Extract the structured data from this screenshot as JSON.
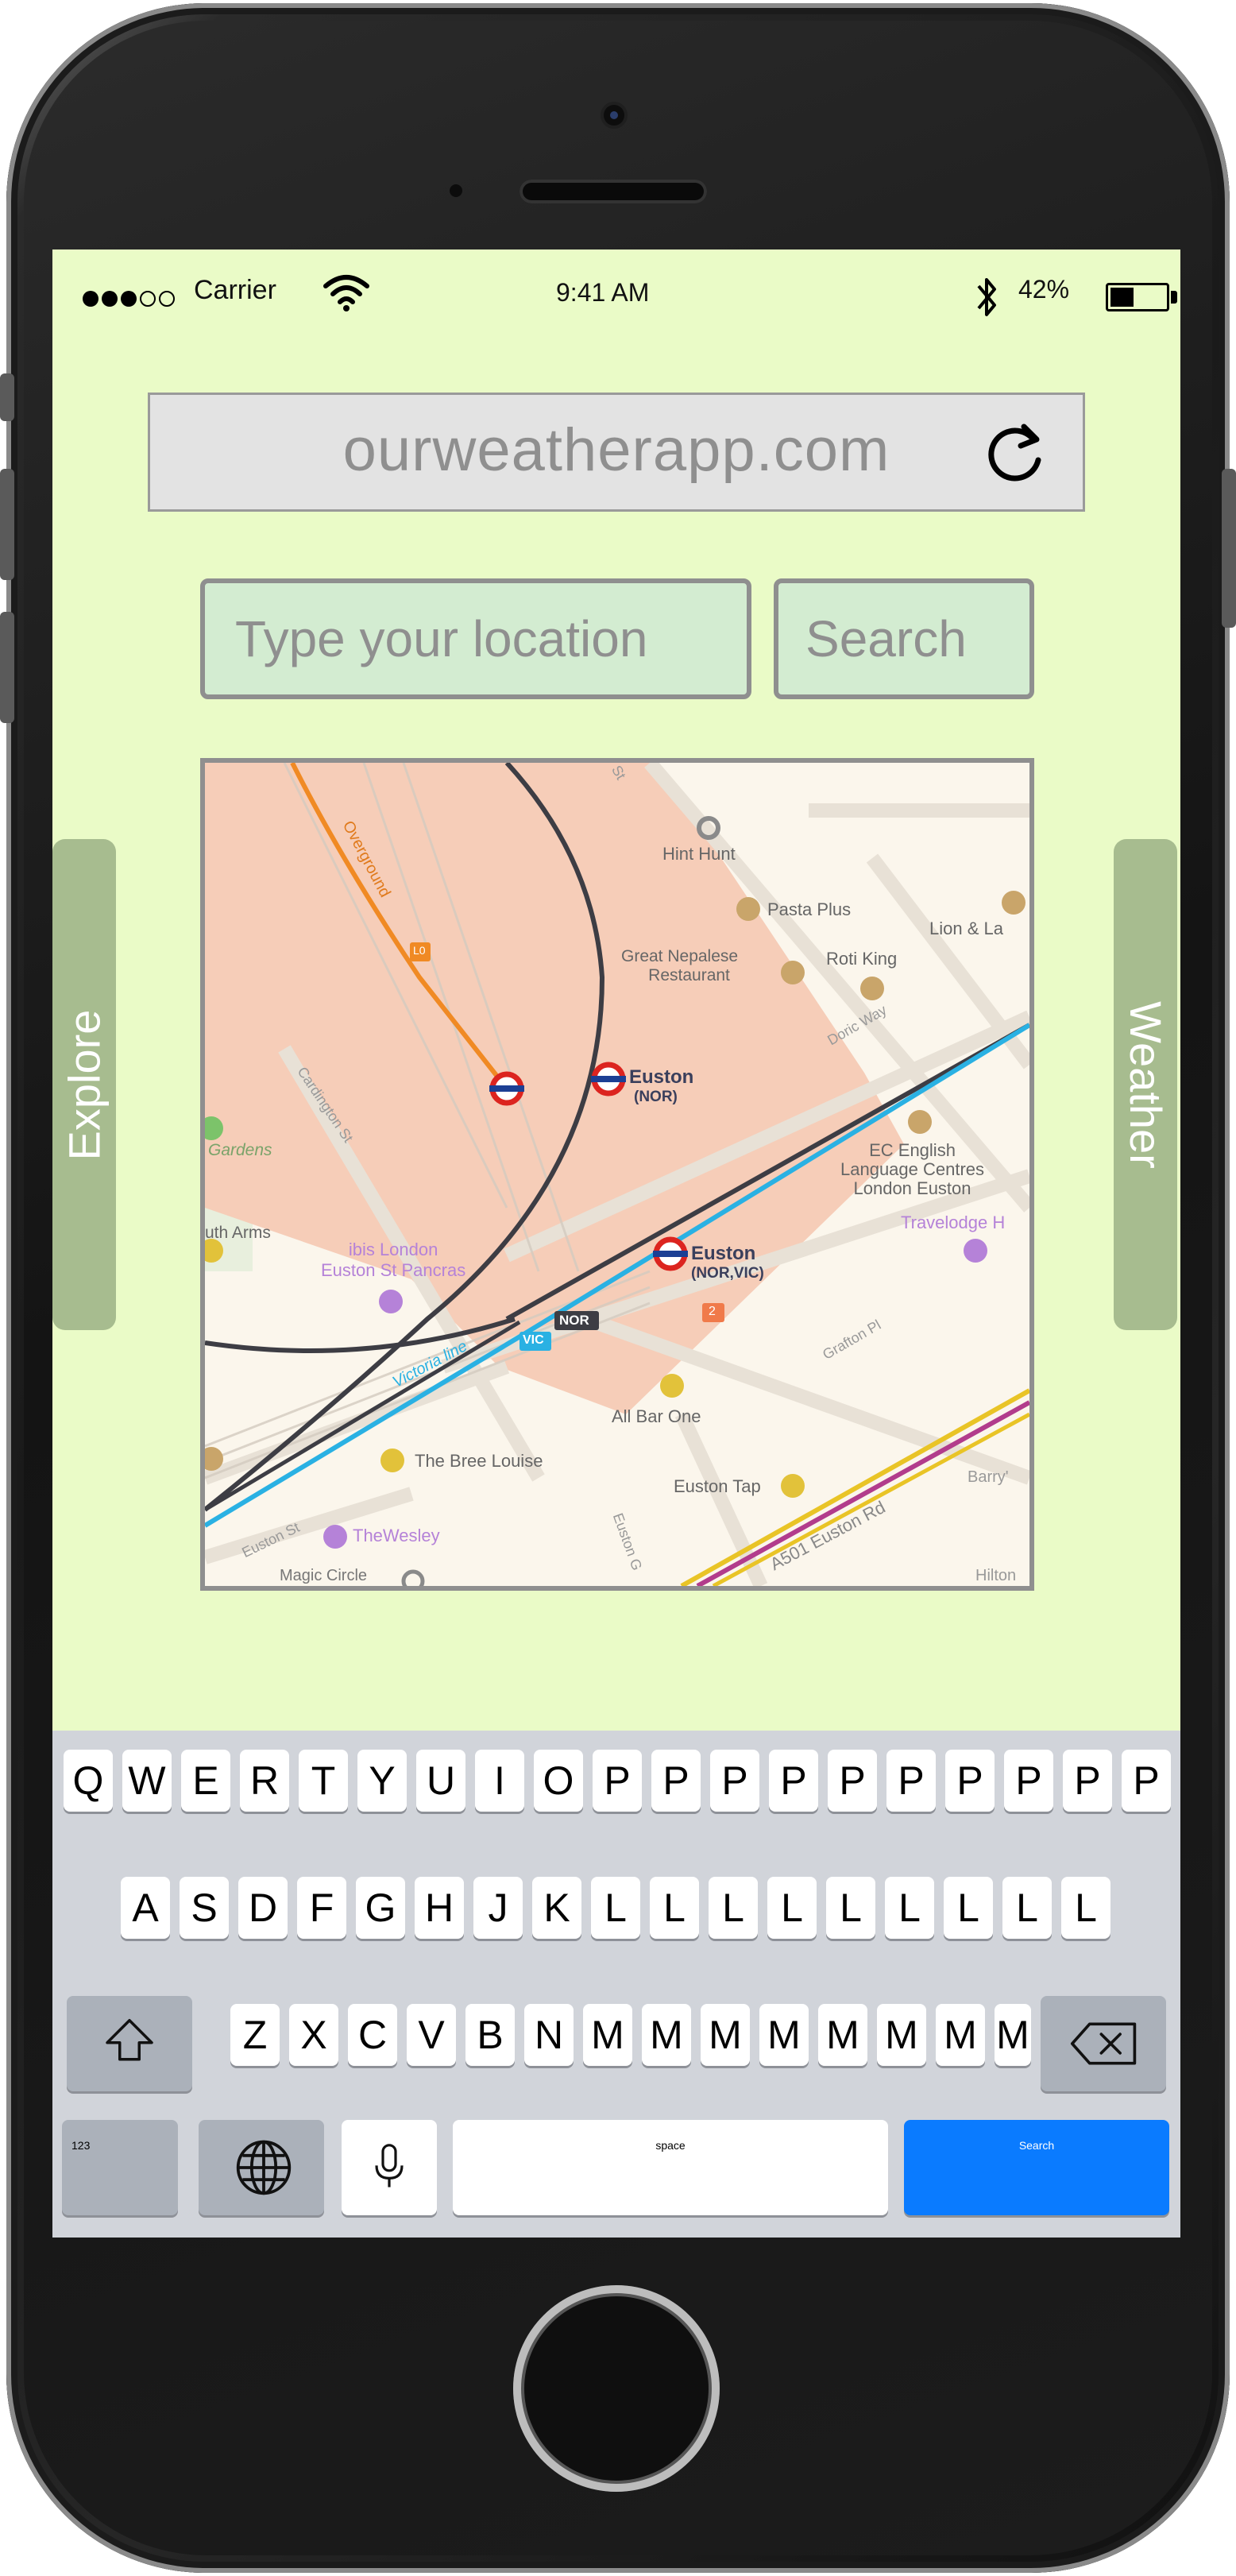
{
  "status_bar": {
    "carrier": "Carrier",
    "time": "9:41 AM",
    "battery": "42%",
    "battery_level": 0.42
  },
  "browser": {
    "url": "ourweatherapp.com"
  },
  "search": {
    "placeholder": "Type your location",
    "button_label": "Search"
  },
  "side_tabs": {
    "left": "Explore",
    "right": "Weather"
  },
  "map": {
    "labels": {
      "hint_hunt": "Hint Hunt",
      "pasta_plus": "Pasta Plus",
      "lion": "Lion & La",
      "great_nepalese_1": "Great Nepalese",
      "great_nepalese_2": "Restaurant",
      "roti_king": "Roti King",
      "doric_way": "Doric Way",
      "overground": "Overground",
      "l0": "L0",
      "euston_nor": "Euston",
      "euston_nor_sub": "(NOR)",
      "cardington": "Cardington St",
      "gardens": "Gardens",
      "ec_english_1": "EC English",
      "ec_english_2": "Language Centres",
      "ec_english_3": "London Euston",
      "travelodge": "Travelodge H",
      "arms": "uth Arms",
      "ibis_1": "ibis London",
      "ibis_2": "Euston St Pancras",
      "euston_vic": "Euston",
      "euston_vic_sub": "(NOR,VIC)",
      "nor": "NOR",
      "vic": "VIC",
      "two": "2",
      "victoria_line": "Victoria line",
      "grafton": "Grafton Pl",
      "all_bar_one": "All Bar One",
      "bree_louise": "The Bree Louise",
      "euston_tap": "Euston Tap",
      "barry": "Barry'",
      "euston_st": "Euston St",
      "the_wesley": "TheWesley",
      "euston_rd": "A501  Euston Rd",
      "euston_g": "Euston G",
      "magic_circle": "Magic Circle",
      "hilton": "Hilton",
      "st": "St"
    }
  },
  "keyboard": {
    "row1": [
      "Q",
      "W",
      "E",
      "R",
      "T",
      "Y",
      "U",
      "I",
      "O",
      "P",
      "P",
      "P",
      "P",
      "P",
      "P",
      "P",
      "P",
      "P",
      "P"
    ],
    "row2": [
      "A",
      "S",
      "D",
      "F",
      "G",
      "H",
      "J",
      "K",
      "L",
      "L",
      "L",
      "L",
      "L",
      "L",
      "L",
      "L",
      "L"
    ],
    "row3": [
      "Z",
      "X",
      "C",
      "V",
      "B",
      "N",
      "M",
      "M",
      "M",
      "M",
      "M",
      "M",
      "M",
      "M"
    ],
    "numbers_label": "123",
    "space_label": "space",
    "action_label": "Search"
  }
}
